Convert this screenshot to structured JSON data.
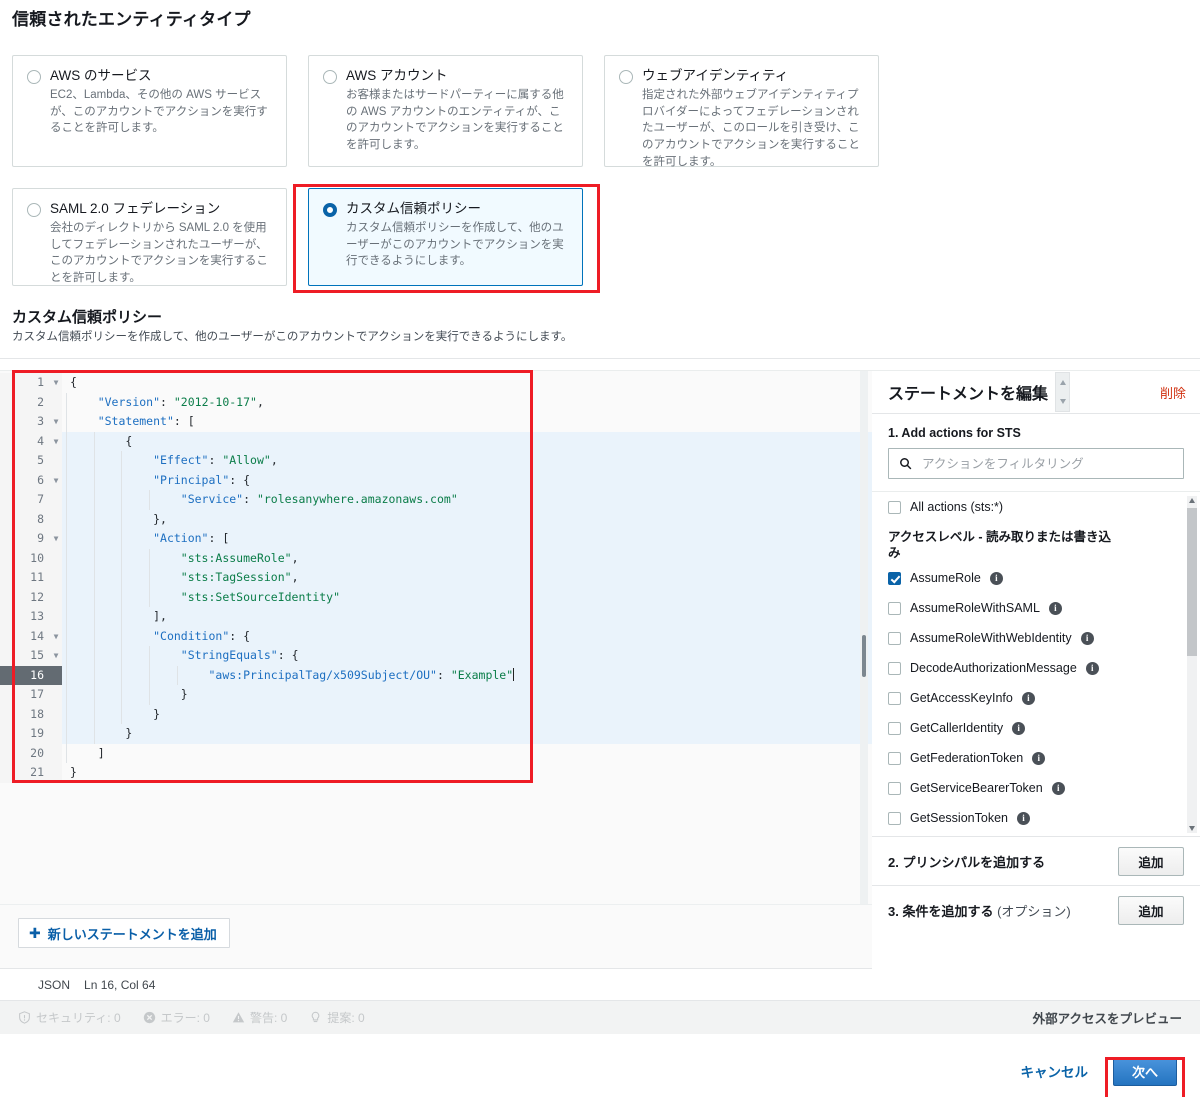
{
  "page": {
    "title": "信頼されたエンティティタイプ",
    "subsection_title": "カスタム信頼ポリシー",
    "subsection_desc": "カスタム信頼ポリシーを作成して、他のユーザーがこのアカウントでアクションを実行できるようにします。"
  },
  "entity_cards": [
    {
      "title": "AWS のサービス",
      "desc": "EC2、Lambda、その他の AWS サービスが、このアカウントでアクションを実行することを許可します。",
      "selected": false
    },
    {
      "title": "AWS アカウント",
      "desc": "お客様またはサードパーティーに属する他の AWS アカウントのエンティティが、このアカウントでアクションを実行することを許可します。",
      "selected": false
    },
    {
      "title": "ウェブアイデンティティ",
      "desc": "指定された外部ウェブアイデンティティプロバイダーによってフェデレーションされたユーザーが、このロールを引き受け、このアカウントでアクションを実行することを許可します。",
      "selected": false
    },
    {
      "title": "SAML 2.0 フェデレーション",
      "desc": "会社のディレクトリから SAML 2.0 を使用してフェデレーションされたユーザーが、このアカウントでアクションを実行することを許可します。",
      "selected": false
    },
    {
      "title": "カスタム信頼ポリシー",
      "desc": "カスタム信頼ポリシーを作成して、他のユーザーがこのアカウントでアクションを実行できるようにします。",
      "selected": true
    }
  ],
  "editor": {
    "code_lines": [
      {
        "num": "1",
        "fold": true,
        "text": "{"
      },
      {
        "num": "2",
        "fold": false,
        "text": "    \"Version\": \"2012-10-17\","
      },
      {
        "num": "3",
        "fold": true,
        "text": "    \"Statement\": ["
      },
      {
        "num": "4",
        "fold": true,
        "text": "        {"
      },
      {
        "num": "5",
        "fold": false,
        "text": "            \"Effect\": \"Allow\","
      },
      {
        "num": "6",
        "fold": true,
        "text": "            \"Principal\": {"
      },
      {
        "num": "7",
        "fold": false,
        "text": "                \"Service\": \"rolesanywhere.amazonaws.com\""
      },
      {
        "num": "8",
        "fold": false,
        "text": "            },"
      },
      {
        "num": "9",
        "fold": true,
        "text": "            \"Action\": ["
      },
      {
        "num": "10",
        "fold": false,
        "text": "                \"sts:AssumeRole\","
      },
      {
        "num": "11",
        "fold": false,
        "text": "                \"sts:TagSession\","
      },
      {
        "num": "12",
        "fold": false,
        "text": "                \"sts:SetSourceIdentity\""
      },
      {
        "num": "13",
        "fold": false,
        "text": "            ],"
      },
      {
        "num": "14",
        "fold": true,
        "text": "            \"Condition\": {"
      },
      {
        "num": "15",
        "fold": true,
        "text": "                \"StringEquals\": {"
      },
      {
        "num": "16",
        "fold": false,
        "text": "                    \"aws:PrincipalTag/x509Subject/OU\": \"Example\""
      },
      {
        "num": "17",
        "fold": false,
        "text": "                }"
      },
      {
        "num": "18",
        "fold": false,
        "text": "            }"
      },
      {
        "num": "19",
        "fold": false,
        "text": "        }"
      },
      {
        "num": "20",
        "fold": false,
        "text": "    ]"
      },
      {
        "num": "21",
        "fold": false,
        "text": "}"
      }
    ],
    "add_statement_label": "新しいステートメントを追加",
    "language": "JSON",
    "cursor_position": "Ln 16, Col 64",
    "problems": [
      {
        "icon": "shield-icon",
        "label": "セキュリティ: 0"
      },
      {
        "icon": "error-icon",
        "label": "エラー: 0"
      },
      {
        "icon": "warning-icon",
        "label": "警告: 0"
      },
      {
        "icon": "bulb-icon",
        "label": "提案: 0"
      }
    ],
    "preview_external_access": "外部アクセスをプレビュー"
  },
  "statement_panel": {
    "title": "ステートメントを編集",
    "delete_label": "削除",
    "step1_label": "1. Add actions for STS",
    "filter_placeholder": "アクションをフィルタリング",
    "filter_value": "",
    "all_actions": {
      "label": "All actions (sts:*)",
      "checked": false
    },
    "access_level_label": "アクセスレベル - 読み取りまたは書き込み",
    "actions": [
      {
        "label": "AssumeRole",
        "checked": true
      },
      {
        "label": "AssumeRoleWithSAML",
        "checked": false
      },
      {
        "label": "AssumeRoleWithWebIdentity",
        "checked": false
      },
      {
        "label": "DecodeAuthorizationMessage",
        "checked": false
      },
      {
        "label": "GetAccessKeyInfo",
        "checked": false
      },
      {
        "label": "GetCallerIdentity",
        "checked": false
      },
      {
        "label": "GetFederationToken",
        "checked": false
      },
      {
        "label": "GetServiceBearerToken",
        "checked": false
      },
      {
        "label": "GetSessionToken",
        "checked": false
      }
    ],
    "step2_label": "2. プリンシパルを追加する",
    "step2_button": "追加",
    "step3_label": "3. 条件を追加する",
    "step3_label_optional": "(オプション)",
    "step3_button": "追加"
  },
  "footer": {
    "cancel_label": "キャンセル",
    "next_label": "次へ"
  },
  "colors": {
    "accent_blue": "#0a63a8",
    "selected_card_bg": "#f1faff",
    "delete_red": "#d13212",
    "annotation_red": "#ee1c25",
    "code_key": "#1d6fc1",
    "code_string": "#0b7d49"
  }
}
